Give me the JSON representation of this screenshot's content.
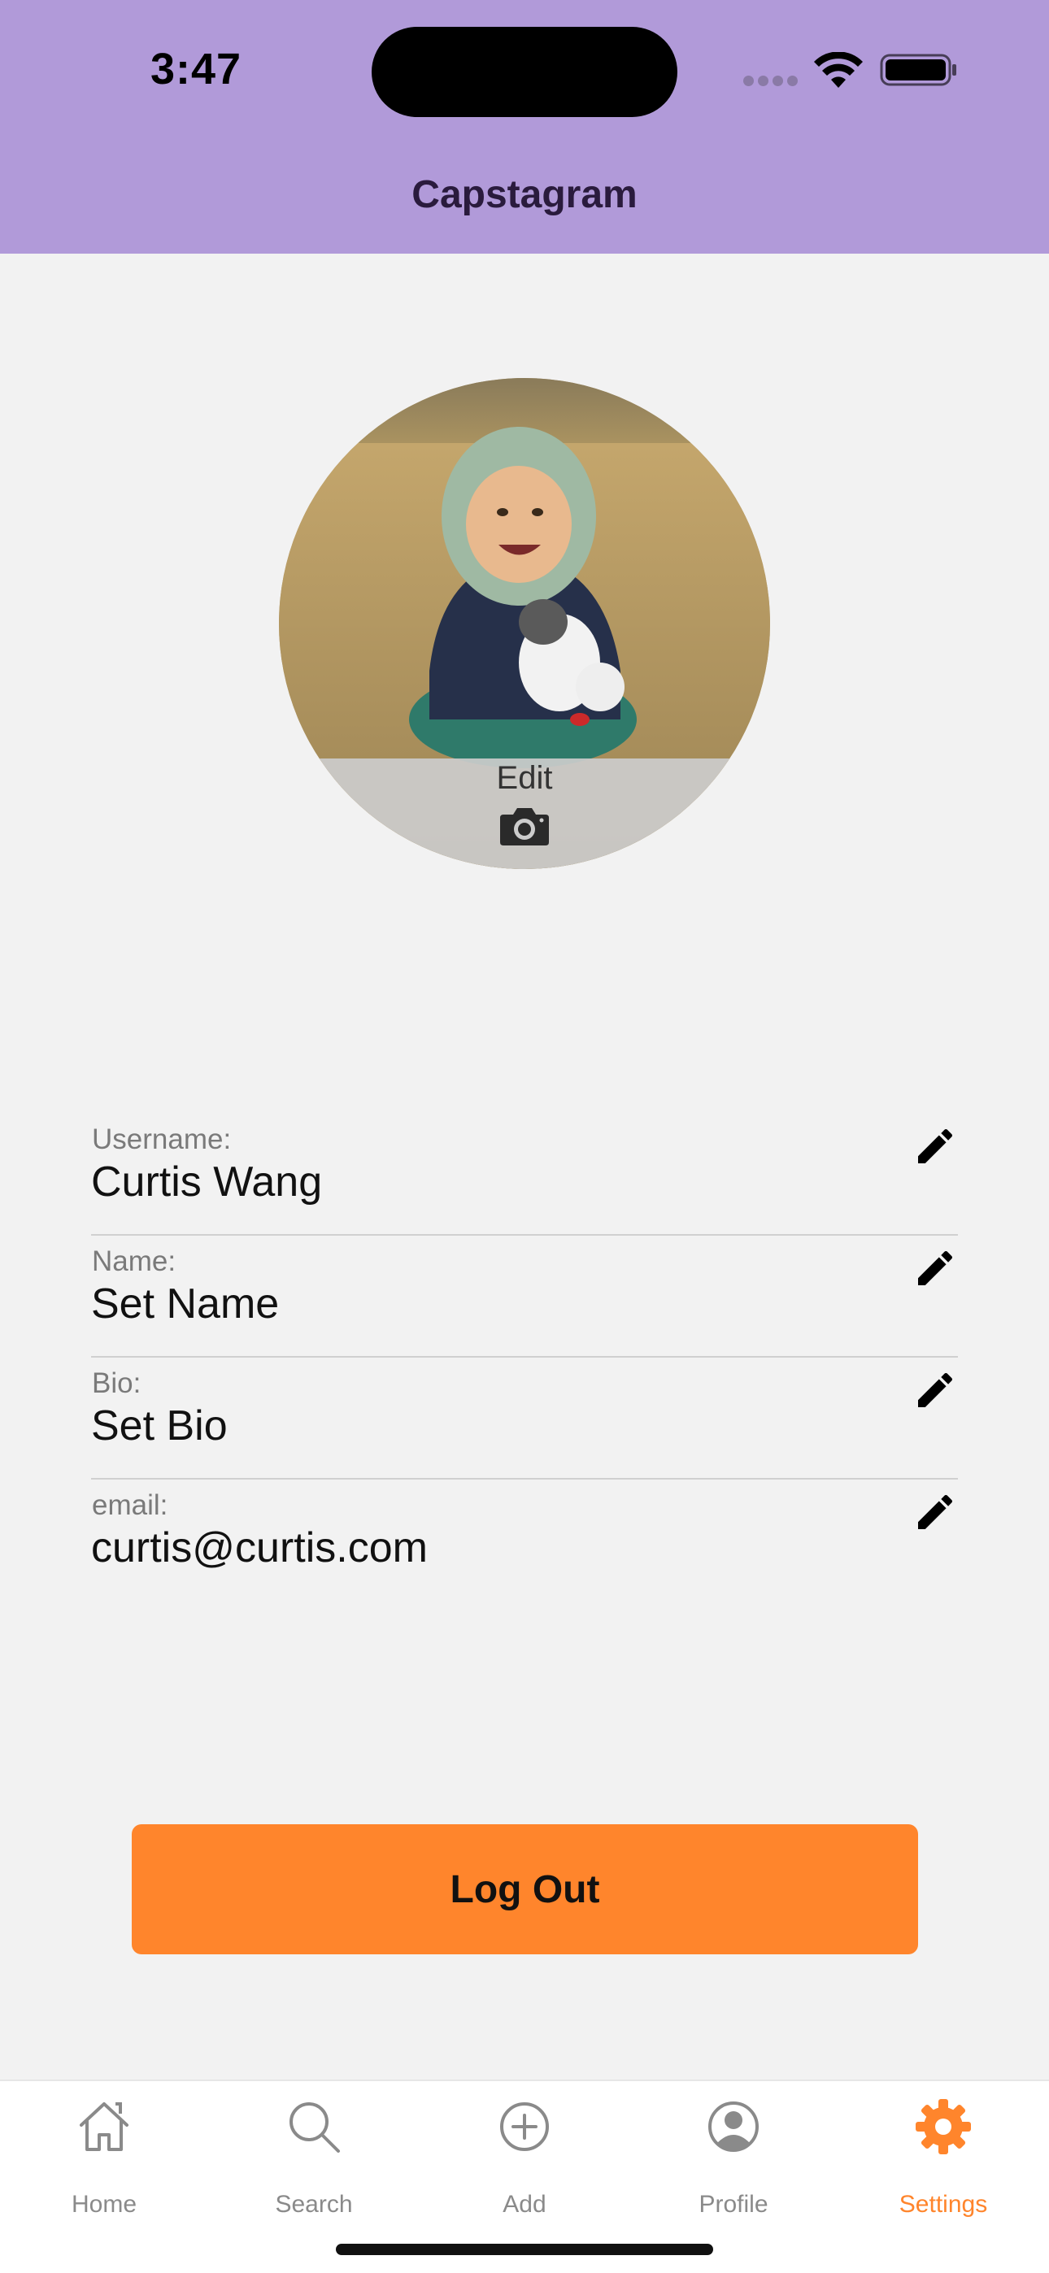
{
  "status_bar": {
    "time": "3:47"
  },
  "header": {
    "title": "Capstagram"
  },
  "avatar": {
    "edit_label": "Edit"
  },
  "fields": [
    {
      "label": "Username:",
      "value": "Curtis Wang"
    },
    {
      "label": "Name:",
      "value": "Set Name"
    },
    {
      "label": "Bio:",
      "value": "Set Bio"
    },
    {
      "label": "email:",
      "value": "curtis@curtis.com"
    }
  ],
  "logout": {
    "label": "Log Out"
  },
  "tabs": [
    {
      "label": "Home",
      "icon": "home-icon"
    },
    {
      "label": "Search",
      "icon": "search-icon"
    },
    {
      "label": "Add",
      "icon": "add-circle-icon"
    },
    {
      "label": "Profile",
      "icon": "profile-icon"
    },
    {
      "label": "Settings",
      "icon": "gear-icon",
      "active": true
    }
  ],
  "colors": {
    "header_bg": "#b19ad9",
    "accent": "#ff852c",
    "background": "#f2f2f2"
  }
}
